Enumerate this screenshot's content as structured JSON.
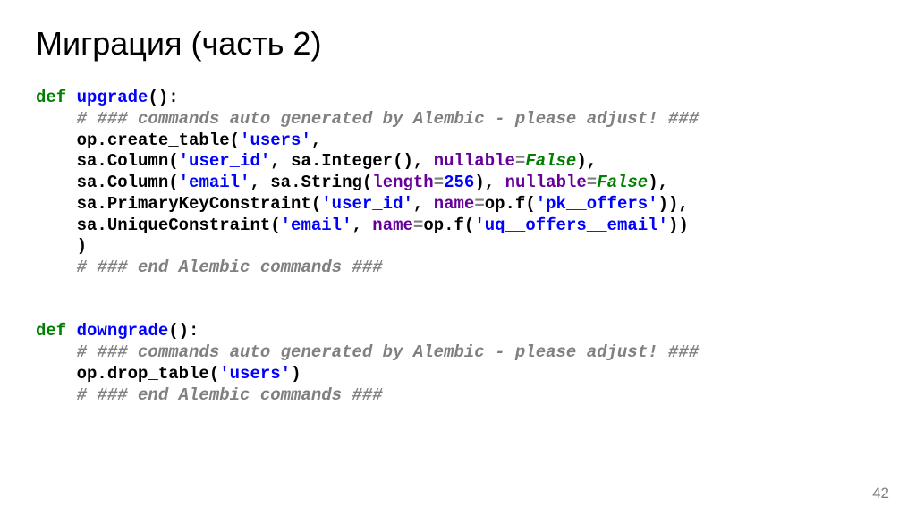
{
  "title": "Миграция (часть 2)",
  "page_number": "42",
  "color": {
    "keyword": "#007f00",
    "string": "#0000ff",
    "comment": "#808080",
    "argname": "#660099"
  },
  "code": {
    "l1": {
      "kw": "def",
      "sp": " ",
      "fn": "upgrade",
      "rest": "():"
    },
    "l2": {
      "indent": "    ",
      "cm": "# ### commands auto generated by Alembic - please adjust! ###"
    },
    "l3": {
      "indent": "    ",
      "p1": "op.create_table(",
      "s1": "'users'",
      "p2": ","
    },
    "l4": {
      "indent": "    ",
      "p1": "sa.Column(",
      "s1": "'user_id'",
      "p2": ", sa.Integer(), ",
      "arg": "nullable",
      "eq": "=",
      "val": "False",
      "p3": "),"
    },
    "l5": {
      "indent": "    ",
      "p1": "sa.Column(",
      "s1": "'email'",
      "p2": ", sa.String(",
      "arg1": "length",
      "eq1": "=",
      "num": "256",
      "p3": "), ",
      "arg2": "nullable",
      "eq2": "=",
      "val": "False",
      "p4": "),"
    },
    "l6": {
      "indent": "    ",
      "p1": "sa.PrimaryKeyConstraint(",
      "s1": "'user_id'",
      "p2": ", ",
      "arg": "name",
      "eq": "=",
      "p3": "op.f(",
      "s2": "'pk__offers'",
      "p4": ")),"
    },
    "l7": {
      "indent": "    ",
      "p1": "sa.UniqueConstraint(",
      "s1": "'email'",
      "p2": ", ",
      "arg": "name",
      "eq": "=",
      "p3": "op.f(",
      "s2": "'uq__offers__email'",
      "p4": "))"
    },
    "l8": {
      "indent": "    ",
      "p1": ")"
    },
    "l9": {
      "indent": "    ",
      "cm": "# ### end Alembic commands ###"
    },
    "l11": {
      "kw": "def",
      "sp": " ",
      "fn": "downgrade",
      "rest": "():"
    },
    "l12": {
      "indent": "    ",
      "cm": "# ### commands auto generated by Alembic - please adjust! ###"
    },
    "l13": {
      "indent": "    ",
      "p1": "op.drop_table(",
      "s1": "'users'",
      "p2": ")"
    },
    "l14": {
      "indent": "    ",
      "cm": "# ### end Alembic commands ###"
    }
  }
}
